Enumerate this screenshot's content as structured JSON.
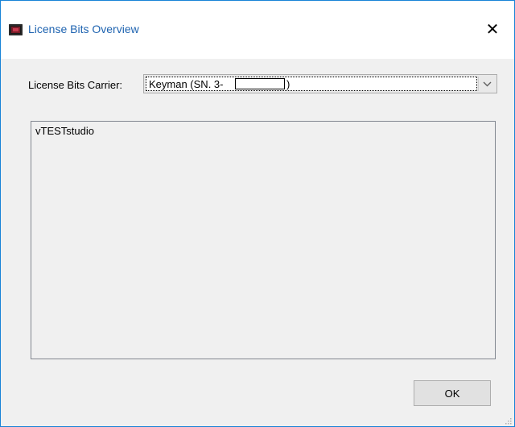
{
  "window": {
    "title": "License Bits Overview",
    "close_glyph": "✕",
    "accent_border": "#1883d7",
    "title_color": "#1e63b0",
    "icon": "app-icon"
  },
  "carrier": {
    "label": "License Bits Carrier:",
    "selected_prefix": "Keyman (SN. 3-",
    "selected_suffix": ")",
    "dropdown_icon": "chevron-down-icon"
  },
  "bits": {
    "items": [
      "vTESTstudio"
    ]
  },
  "footer": {
    "ok_label": "OK",
    "resize_icon": "resize-grip-icon"
  }
}
